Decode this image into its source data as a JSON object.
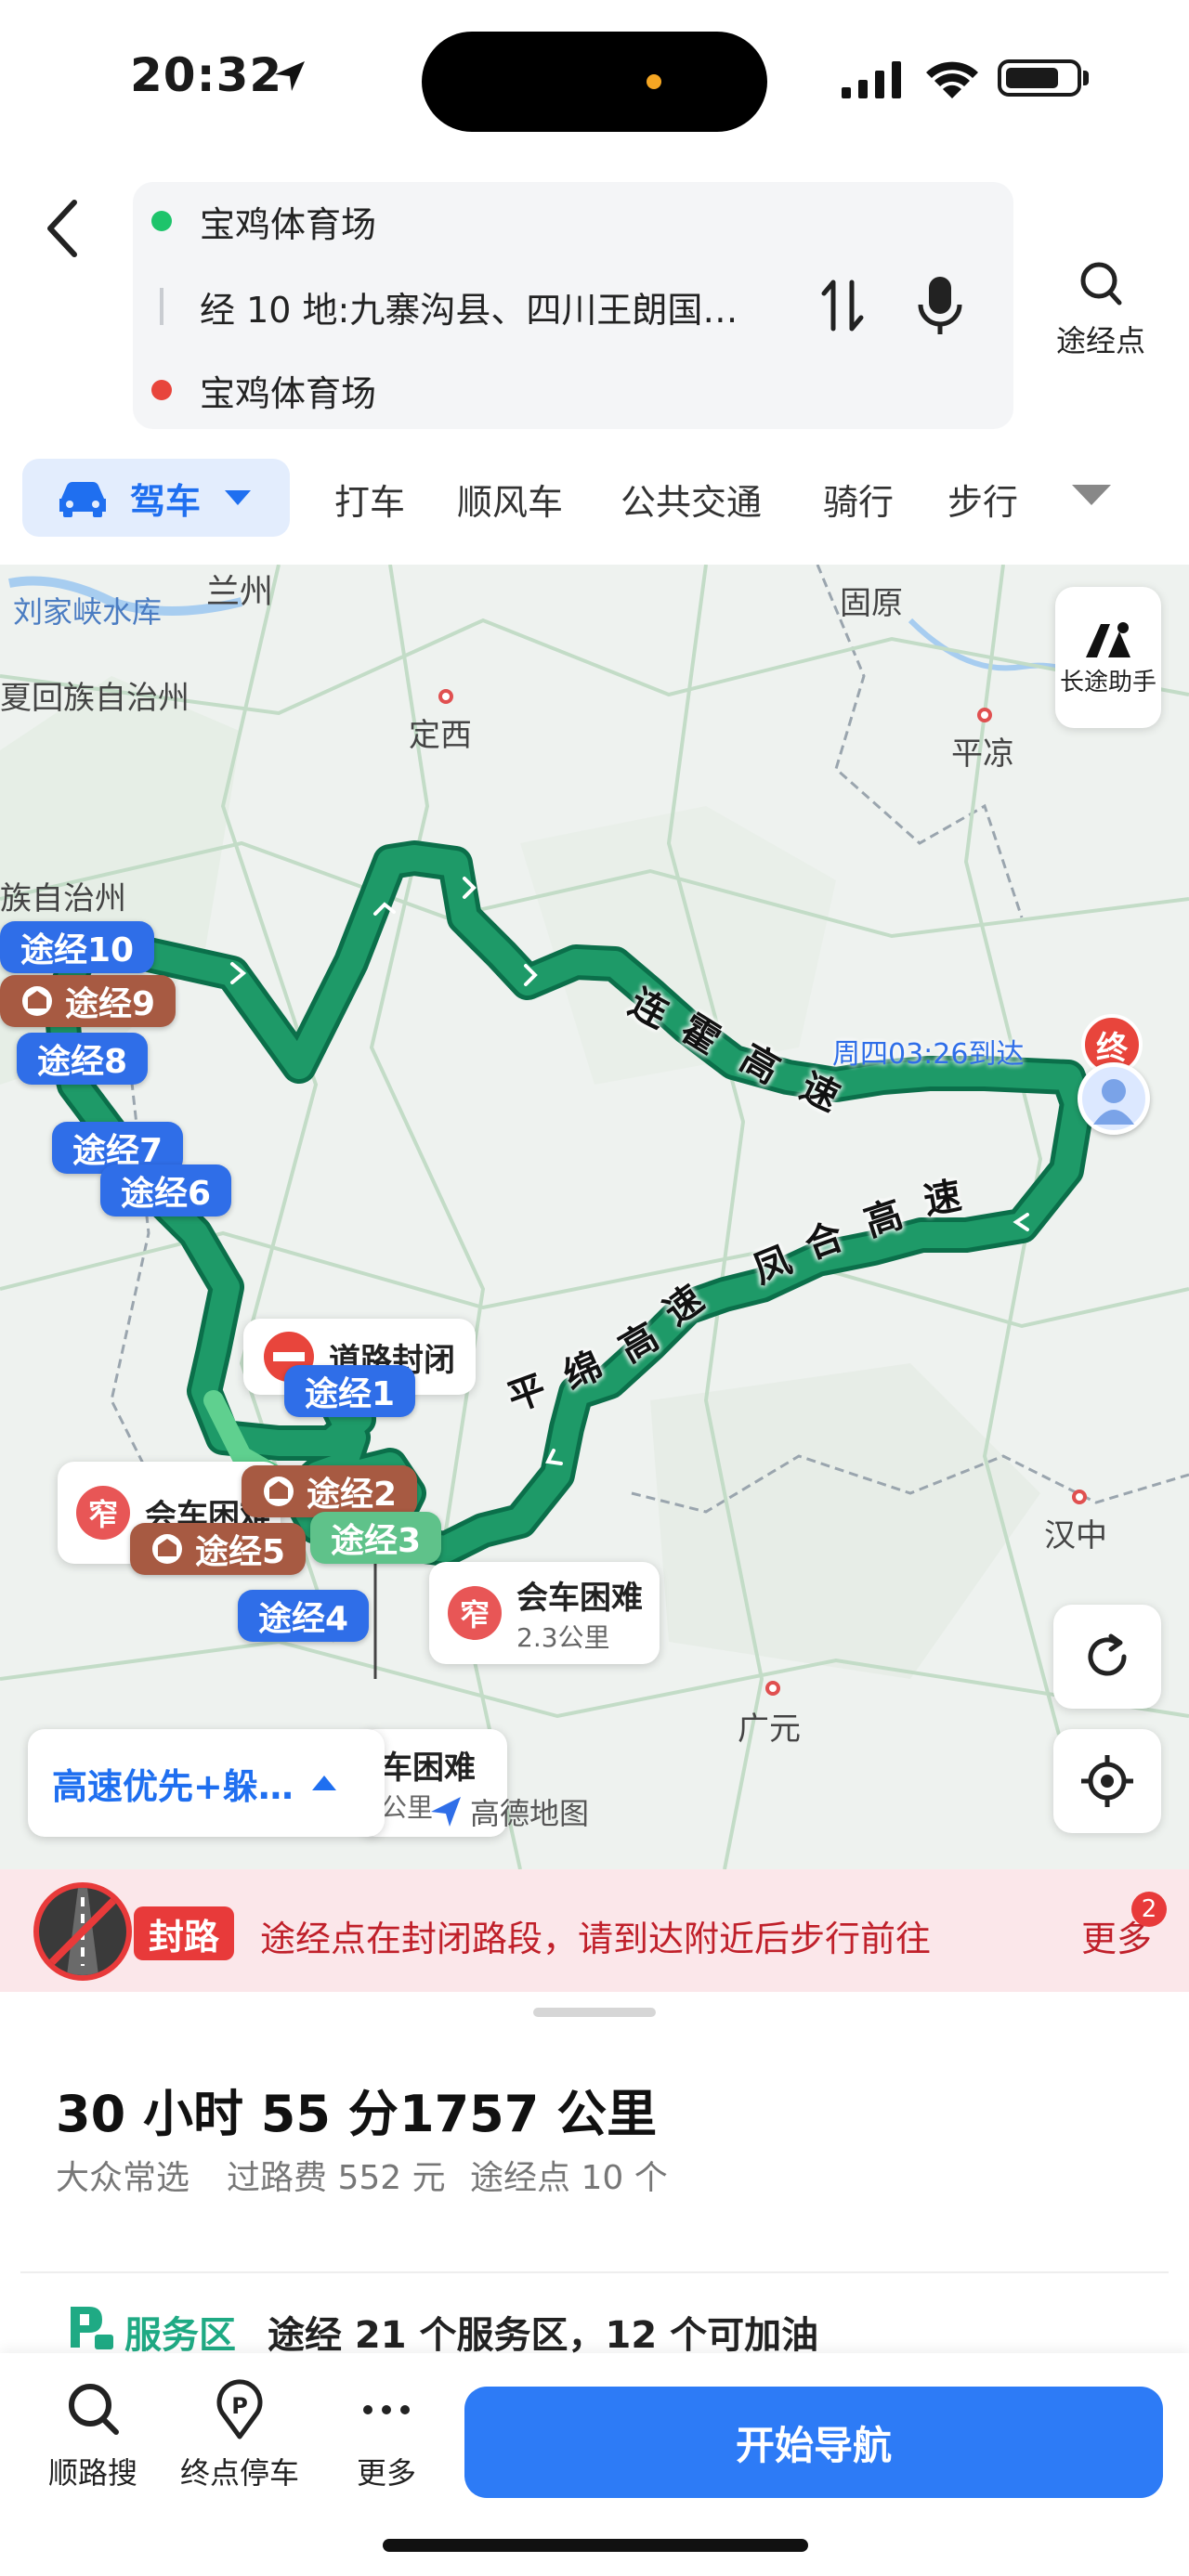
{
  "status": {
    "time": "20:32"
  },
  "route": {
    "origin": "宝鸡体育场",
    "via": "经 10 地:九寨沟县、四川王朗国…",
    "destination": "宝鸡体育场",
    "via_button": "途经点"
  },
  "modes": {
    "active": "驾车",
    "tabs": [
      "打车",
      "顺风车",
      "公共交通",
      "骑行",
      "步行"
    ]
  },
  "map": {
    "places": {
      "lanzhou": "兰州",
      "liujiaxia": "刘家峡水库",
      "guyuan": "固原",
      "ningxia": "夏回族自治州",
      "dingxi": "定西",
      "pingliang": "平凉",
      "zizhizhou": "族自治州",
      "hanzhong": "汉中",
      "guangyuan": "广元"
    },
    "roads": {
      "lianhuo": [
        "连",
        "霍",
        "高",
        "速"
      ],
      "fenghe": [
        "凤",
        "合",
        "高",
        "速"
      ],
      "pingmian": [
        "平",
        "绵",
        "高",
        "速"
      ]
    },
    "arrival": "周四03:26到达",
    "end_marker": "终",
    "long_trip": "长途助手",
    "waypoints": {
      "w10": "途经10",
      "w9": "途经9",
      "w8": "途经8",
      "w7": "途经7",
      "w6": "途经6",
      "w1": "途经1",
      "w2": "途经2",
      "w3": "途经3",
      "w5": "途经5",
      "w4": "途经4"
    },
    "closure_card": "道路封闭",
    "warn_left": {
      "icon": "窄",
      "title": "会车困难"
    },
    "warn_right": {
      "icon": "窄",
      "title": "会车困难",
      "sub": "2.3公里"
    },
    "warn_bottom": {
      "title": "车困难",
      "sub": "公里"
    },
    "preference": "高速优先+躲…",
    "logo": "高德地图"
  },
  "closure": {
    "tag": "封路",
    "text": "途经点在封闭路段，请到达附近后步行前往",
    "more": "更多",
    "badge": "2"
  },
  "summary": {
    "time": "30 小时 55 分",
    "distance": "1757 公里",
    "tag": "大众常选",
    "toll": "过路费 552 元",
    "waypoints": "途经点 10 个"
  },
  "service": {
    "label": "服务区",
    "text": "途经 21 个服务区，12 个可加油"
  },
  "bottom": {
    "search": "顺路搜",
    "parking": "终点停车",
    "more": "更多",
    "navigate": "开始导航"
  },
  "colors": {
    "accent": "#2d7bf6",
    "route": "#0f8a5c",
    "closure": "#e83a3a",
    "service": "#1faa84"
  }
}
